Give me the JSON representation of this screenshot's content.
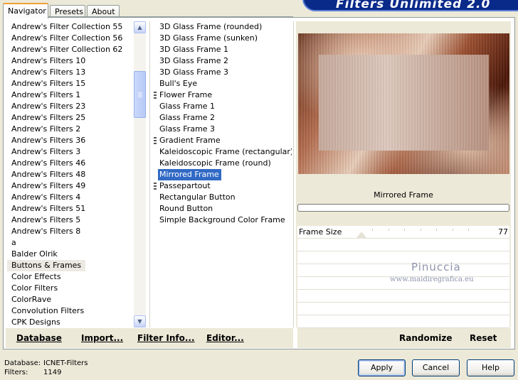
{
  "app": {
    "title": "Filters Unlimited 2.0"
  },
  "tabs": [
    "Navigator",
    "Presets",
    "About"
  ],
  "categories": [
    "Andrew's Filter Collection 55",
    "Andrew's Filter Collection 56",
    "Andrew's Filter Collection 62",
    "Andrew's Filters 10",
    "Andrew's Filters 13",
    "Andrew's Filters 15",
    "Andrew's Filters 1",
    "Andrew's Filters 23",
    "Andrew's Filters 25",
    "Andrew's Filters 2",
    "Andrew's Filters 36",
    "Andrew's Filters 3",
    "Andrew's Filters 46",
    "Andrew's Filters 48",
    "Andrew's Filters 49",
    "Andrew's Filters 4",
    "Andrew's Filters 51",
    "Andrew's Filters 5",
    "Andrew's Filters 8",
    "a",
    "Balder Olrik",
    "Buttons & Frames",
    "Color Effects",
    "Color Filters",
    "ColorRave",
    "Convolution Filters",
    "CPK Designs"
  ],
  "selected_category": "Buttons & Frames",
  "filters": [
    {
      "label": "3D Glass Frame (rounded)",
      "marked": false
    },
    {
      "label": "3D Glass Frame (sunken)",
      "marked": false
    },
    {
      "label": "3D Glass Frame 1",
      "marked": false
    },
    {
      "label": "3D Glass Frame 2",
      "marked": false
    },
    {
      "label": "3D Glass Frame 3",
      "marked": false
    },
    {
      "label": "Bull's Eye",
      "marked": false
    },
    {
      "label": "Flower Frame",
      "marked": true
    },
    {
      "label": "Glass Frame 1",
      "marked": false
    },
    {
      "label": "Glass Frame 2",
      "marked": false
    },
    {
      "label": "Glass Frame 3",
      "marked": false
    },
    {
      "label": "Gradient Frame",
      "marked": true
    },
    {
      "label": "Kaleidoscopic Frame (rectangular)",
      "marked": false
    },
    {
      "label": "Kaleidoscopic Frame (round)",
      "marked": false
    },
    {
      "label": "Mirrored Frame",
      "marked": false
    },
    {
      "label": "Passepartout",
      "marked": true
    },
    {
      "label": "Rectangular Button",
      "marked": false
    },
    {
      "label": "Round Button",
      "marked": false
    },
    {
      "label": "Simple Background Color Frame",
      "marked": false
    }
  ],
  "selected_filter": "Mirrored Frame",
  "preview": {
    "caption": "Mirrored Frame"
  },
  "params": [
    {
      "label": "Frame Size",
      "value": "77"
    }
  ],
  "watermark": {
    "name": "Pinuccia",
    "site": "www.maidiregrafica.eu"
  },
  "left_buttons": {
    "database": "Database",
    "import": "Import...",
    "filter_info": "Filter Info...",
    "editor": "Editor..."
  },
  "right_buttons": {
    "randomize": "Randomize",
    "reset": "Reset"
  },
  "status": {
    "database_label": "Database:",
    "database_value": "ICNET-Filters",
    "filters_label": "Filters:",
    "filters_value": "1149"
  },
  "dialog_buttons": {
    "apply": "Apply",
    "cancel": "Cancel",
    "help": "Help"
  },
  "colors": {
    "selection": "#316ac5",
    "window_bg": "#ece9d8",
    "banner": "#0a2a8a"
  },
  "icons": {
    "scroll_up": "arrow-up-icon",
    "scroll_down": "arrow-down-icon"
  }
}
